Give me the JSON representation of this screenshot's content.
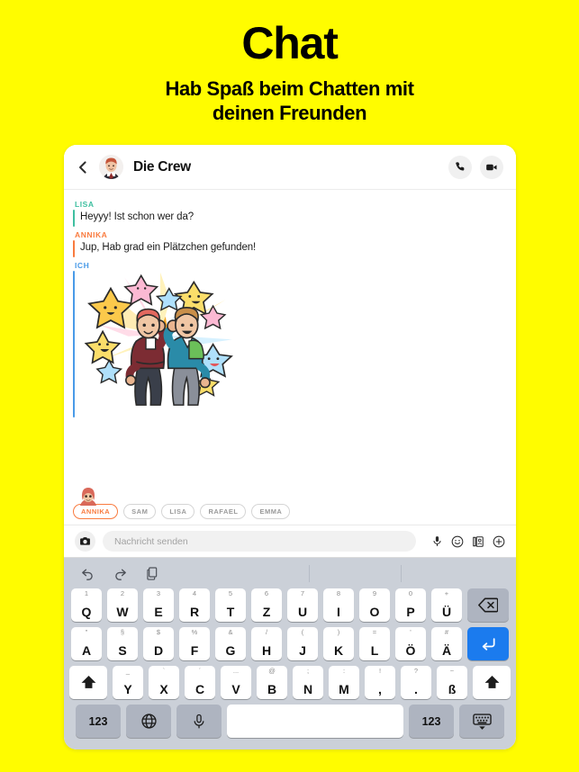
{
  "promo": {
    "title": "Chat",
    "subtitle_line1": "Hab Spaß beim Chatten mit",
    "subtitle_line2": "deinen Freunden"
  },
  "colors": {
    "background": "#FFFC00",
    "lisa": "#3FBFA0",
    "annika": "#F97B3F",
    "ich": "#4A9BE8",
    "enter_key": "#1B7BEE",
    "keyboard_bg": "#CBD0D8",
    "key_fn": "#AEB4C0"
  },
  "chat_header": {
    "back_icon": "chevron-left-icon",
    "avatar": "group-avatar",
    "title": "Die Crew",
    "call_icon": "phone-icon",
    "video_icon": "video-camera-icon"
  },
  "messages": [
    {
      "sender": "LISA",
      "color": "#3FBFA0",
      "text": "Heyyy! Ist schon wer da?",
      "type": "text"
    },
    {
      "sender": "ANNIKA",
      "color": "#F97B3F",
      "text": "Jup, Hab grad ein Plätzchen gefunden!",
      "type": "text"
    },
    {
      "sender": "ICH",
      "color": "#4A9BE8",
      "text": "",
      "type": "sticker",
      "sticker_description": "Zwei Bitmoji-Figuren geben sich ein High-Five, umgeben von bunten Sternen"
    }
  ],
  "participants": {
    "active_avatar": "annika-bitmoji",
    "chips": [
      {
        "label": "ANNIKA",
        "active": true
      },
      {
        "label": "SAM",
        "active": false
      },
      {
        "label": "LISA",
        "active": false
      },
      {
        "label": "RAFAEL",
        "active": false
      },
      {
        "label": "EMMA",
        "active": false
      }
    ]
  },
  "input_bar": {
    "camera_icon": "camera-icon",
    "placeholder": "Nachricht senden",
    "value": "",
    "icons": [
      "microphone-icon",
      "emoji-smiley-icon",
      "bitmoji-sticker-icon",
      "plus-circle-icon"
    ]
  },
  "keyboard": {
    "toolbar": [
      "undo-icon",
      "redo-icon",
      "paste-icon"
    ],
    "row1": [
      {
        "alt": "1",
        "main": "Q"
      },
      {
        "alt": "2",
        "main": "W"
      },
      {
        "alt": "3",
        "main": "E"
      },
      {
        "alt": "4",
        "main": "R"
      },
      {
        "alt": "5",
        "main": "T"
      },
      {
        "alt": "6",
        "main": "Z"
      },
      {
        "alt": "7",
        "main": "U"
      },
      {
        "alt": "8",
        "main": "I"
      },
      {
        "alt": "9",
        "main": "O"
      },
      {
        "alt": "0",
        "main": "P"
      },
      {
        "alt": "+",
        "main": "Ü"
      }
    ],
    "row1_action": {
      "name": "backspace-key",
      "icon": "backspace-icon"
    },
    "row2": [
      {
        "alt": "\"",
        "main": "A"
      },
      {
        "alt": "§",
        "main": "S"
      },
      {
        "alt": "$",
        "main": "D"
      },
      {
        "alt": "%",
        "main": "F"
      },
      {
        "alt": "&",
        "main": "G"
      },
      {
        "alt": "/",
        "main": "H"
      },
      {
        "alt": "(",
        "main": "J"
      },
      {
        "alt": ")",
        "main": "K"
      },
      {
        "alt": "=",
        "main": "L"
      },
      {
        "alt": "'",
        "main": "Ö"
      },
      {
        "alt": "#",
        "main": "Ä"
      }
    ],
    "row2_action": {
      "name": "enter-key",
      "icon": "return-arrow-icon"
    },
    "row3": [
      {
        "alt": "_",
        "main": "Y"
      },
      {
        "alt": "`",
        "main": "X"
      },
      {
        "alt": "´",
        "main": "C"
      },
      {
        "alt": "...",
        "main": "V"
      },
      {
        "alt": "@",
        "main": "B"
      },
      {
        "alt": ";",
        "main": "N"
      },
      {
        "alt": ":",
        "main": "M"
      },
      {
        "alt": "!",
        "main": ","
      },
      {
        "alt": "?",
        "main": "."
      },
      {
        "alt": "~",
        "main": "ß"
      }
    ],
    "row3_shift_left": {
      "name": "shift-key-left",
      "icon": "shift-arrow-icon"
    },
    "row3_shift_right": {
      "name": "shift-key-right",
      "icon": "shift-arrow-icon"
    },
    "row4": {
      "numbers_left": "123",
      "globe_icon": "globe-icon",
      "mic_icon": "microphone-icon",
      "space": "",
      "numbers_right": "123",
      "dismiss_icon": "keyboard-dismiss-icon"
    }
  }
}
